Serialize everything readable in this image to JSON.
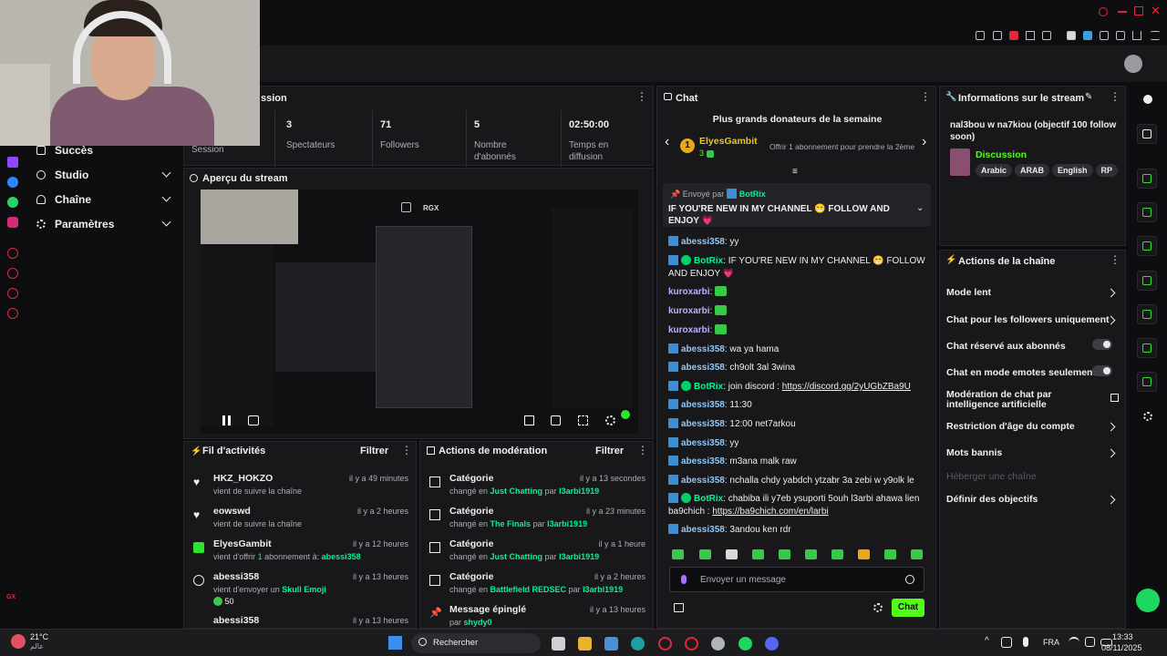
{
  "nav": {
    "items": [
      {
        "label": "Succès",
        "chevron": false
      },
      {
        "label": "Studio",
        "chevron": true
      },
      {
        "label": "Chaîne",
        "chevron": true
      },
      {
        "label": "Paramètres",
        "chevron": true
      }
    ]
  },
  "session": {
    "title_fragment": "ssion",
    "first_stat_label": "Session",
    "stats": [
      {
        "value": "3",
        "label": "Spectateurs"
      },
      {
        "value": "71",
        "label": "Followers"
      },
      {
        "value": "5",
        "label": "Nombre d'abonnés"
      },
      {
        "value": "02:50:00",
        "label": "Temps en diffusion"
      }
    ]
  },
  "preview": {
    "title": "Aperçu du stream",
    "overlay_label": "RGX"
  },
  "activity": {
    "title": "Fil d'activités",
    "filter": "Filtrer",
    "items": [
      {
        "name": "HKZ_HOKZO",
        "time": "il y a 49 minutes",
        "sub": "vient de suivre la chaîne",
        "icon": "heart-icon"
      },
      {
        "name": "eowswd",
        "time": "il y a 2 heures",
        "sub": "vient de suivre la chaîne",
        "icon": "heart-icon"
      },
      {
        "name": "ElyesGambit",
        "time": "il y a 12 heures",
        "sub_prefix": "vient d'offrir ",
        "sub_count": "1",
        "sub_mid": " abonnement à: ",
        "sub_target": "abessi358",
        "icon": "gift-icon"
      },
      {
        "name": "abessi358",
        "time": "il y a 13 heures",
        "sub_prefix": "vient d'envoyer un ",
        "sub_target": "Skull Emoji",
        "amount": "50",
        "icon": "x-circle-icon"
      },
      {
        "name": "abessi358",
        "time": "il y a 13 heures"
      }
    ]
  },
  "moderation": {
    "title": "Actions de modération",
    "filter": "Filtrer",
    "items": [
      {
        "title": "Catégorie",
        "time": "il y a 13 secondes",
        "prefix": "changé en ",
        "category": "Just Chatting",
        "by": " par ",
        "user": "l3arbi1919"
      },
      {
        "title": "Catégorie",
        "time": "il y a 23 minutes",
        "prefix": "changé en ",
        "category": "The Finals",
        "by": " par ",
        "user": "l3arbi1919"
      },
      {
        "title": "Catégorie",
        "time": "il y a 1 heure",
        "prefix": "changé en ",
        "category": "Just Chatting",
        "by": " par ",
        "user": "l3arbi1919"
      },
      {
        "title": "Catégorie",
        "time": "il y a 2 heures",
        "prefix": "changé en ",
        "category": "Battlefield REDSEC",
        "by": " par ",
        "user": "l3arbi1919"
      },
      {
        "title": "Message épinglé",
        "time": "il y a 13 heures",
        "prefix": "par ",
        "user": "shydy0"
      }
    ]
  },
  "chat": {
    "title": "Chat",
    "donors_title": "Plus grands donateurs de la semaine",
    "donor_rank": "1",
    "donor_name": "ElyesGambit",
    "donor_count": "3",
    "donor_note": "Offrir 1 abonnement pour prendre la 2ème",
    "pinned_by_prefix": "Envoyé par",
    "pinned_by": "BotRix",
    "pinned_text": "IF YOU'RE NEW IN MY CHANNEL 😁 FOLLOW AND ENJOY 💗",
    "messages": [
      {
        "user": "abessi358",
        "type": "b",
        "text": "yy"
      },
      {
        "user": "BotRix",
        "type": "bot",
        "text": "IF YOU'RE NEW IN MY CHANNEL 😁 FOLLOW AND ENJOY 💗"
      },
      {
        "user": "kuroxarbi",
        "type": "k",
        "text": ""
      },
      {
        "user": "kuroxarbi",
        "type": "k",
        "text": ""
      },
      {
        "user": "kuroxarbi",
        "type": "k",
        "text": ""
      },
      {
        "user": "abessi358",
        "type": "b",
        "text": "wa ya hama"
      },
      {
        "user": "abessi358",
        "type": "b",
        "text": "ch9olt 3al 3wina"
      },
      {
        "user": "BotRix",
        "type": "bot",
        "text": "join discord : ",
        "link": "https://discord.gg/2yUGbZBa9U"
      },
      {
        "user": "abessi358",
        "type": "b",
        "text": "11:30"
      },
      {
        "user": "abessi358",
        "type": "b",
        "text": "12:00 net7arkou"
      },
      {
        "user": "abessi358",
        "type": "b",
        "text": "yy"
      },
      {
        "user": "abessi358",
        "type": "b",
        "text": "m3ana malk raw"
      },
      {
        "user": "abessi358",
        "type": "b",
        "text": "nchalla chdy yabdch ytzabr 3a zebi w y9olk le"
      },
      {
        "user": "BotRix",
        "type": "bot",
        "text": "chabiba ili y7eb ysuporti 5ouh l3arbi ahawa lien ba9chich : ",
        "link": "https://ba9chich.com/en/larbi"
      },
      {
        "user": "abessi358",
        "type": "b",
        "text": "3andou ken rdr"
      }
    ],
    "input_placeholder": "Envoyer un message",
    "send_label": "Chat"
  },
  "info": {
    "title": "Informations sur le stream",
    "stream_title": "nal3bou w na7kiou (objectif 100 follow soon)",
    "category": "Discussion",
    "tags": [
      "Arabic",
      "ARAB",
      "English",
      "RP"
    ]
  },
  "channel_actions": {
    "title": "Actions de la chaîne",
    "items": [
      {
        "label": "Mode lent",
        "control": "chevron"
      },
      {
        "label": "Chat pour les followers uniquement",
        "control": "chevron"
      },
      {
        "label": "Chat réservé aux abonnés",
        "control": "toggle"
      },
      {
        "label": "Chat en mode emotes seulement",
        "control": "toggle"
      },
      {
        "label": "Modération de chat par intelligence artificielle",
        "control": "external"
      },
      {
        "label": "Restriction d'âge du compte",
        "control": "chevron"
      },
      {
        "label": "Mots bannis",
        "control": "chevron"
      },
      {
        "label": "Héberger une chaîne",
        "control": "disabled"
      },
      {
        "label": "Définir des objectifs",
        "control": "chevron"
      }
    ]
  },
  "taskbar": {
    "weather_temp": "21°C",
    "weather_note": "عالم",
    "search": "Rechercher",
    "lang": "FRA",
    "time": "13:33",
    "date": "08/11/2025"
  },
  "colors": {
    "accent": "#53fc18",
    "bg": "#0e0e10",
    "panel": "#18181b"
  }
}
